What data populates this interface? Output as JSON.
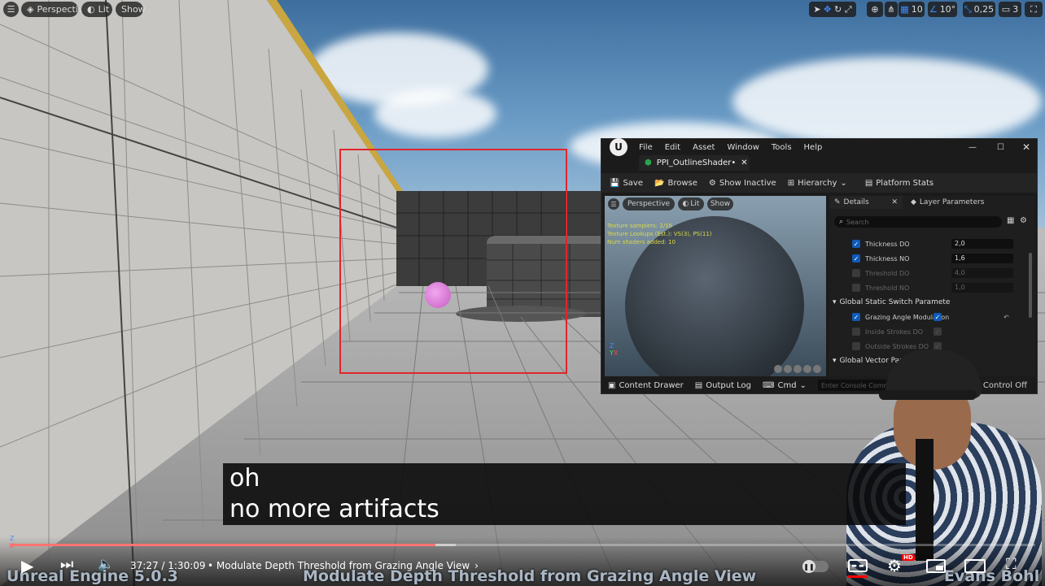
{
  "viewport_toolbar": {
    "perspective": "Perspective",
    "lit": "Lit",
    "show": "Show",
    "grid_snap": "10",
    "rotation_snap": "10°",
    "scale_snap": "0,25",
    "camera_speed": "3"
  },
  "editor": {
    "menu": [
      "File",
      "Edit",
      "Asset",
      "Window",
      "Tools",
      "Help"
    ],
    "tab_title": "PPI_OutlineShader•",
    "toolbar": {
      "save": "Save",
      "browse": "Browse",
      "show_inactive": "Show Inactive",
      "hierarchy": "Hierarchy",
      "platform_stats": "Platform Stats"
    },
    "preview": {
      "perspective": "Perspective",
      "lit": "Lit",
      "show": "Show",
      "stats": [
        "Texture samplers: 2/16",
        "Texture Lookups (Est.): VS(3), PS(11)",
        "Num shaders added: 10"
      ]
    },
    "details": {
      "tab_details": "Details",
      "tab_layer": "Layer Parameters",
      "search_placeholder": "Search",
      "rows": [
        {
          "label": "Thickness DO",
          "value": "2,0",
          "checked": true
        },
        {
          "label": "Thickness NO",
          "value": "1,6",
          "checked": true
        },
        {
          "label": "Threshold DO",
          "value": "4,0",
          "checked": false
        },
        {
          "label": "Threshold NO",
          "value": "1,0",
          "checked": false
        }
      ],
      "section_switch": "Global Static Switch Paramete",
      "switch_rows": [
        {
          "label": "Grazing Angle Modulation",
          "checked": true
        },
        {
          "label": "Inside Strokes DO",
          "checked": false
        },
        {
          "label": "Outside Strokes DO",
          "checked": false
        }
      ],
      "section_vector": "Global Vector Param"
    },
    "bottombar": {
      "content_drawer": "Content Drawer",
      "output_log": "Output Log",
      "cmd": "Cmd",
      "console_placeholder": "Enter Console Command",
      "source_control": "urce Control Off"
    }
  },
  "caption": {
    "line1": "oh",
    "line2": "no more artifacts"
  },
  "player": {
    "time": "37:27 / 1:30:09",
    "chapter": "• Modulate Depth Threshold from Grazing Angle View",
    "progress_fraction": 0.415,
    "hd_badge": "HD"
  },
  "watermark": {
    "left": "Unreal Engine 5.0.3",
    "center": "Modulate Depth Threshold from Grazing Angle View",
    "right": "Evans Bohl"
  }
}
